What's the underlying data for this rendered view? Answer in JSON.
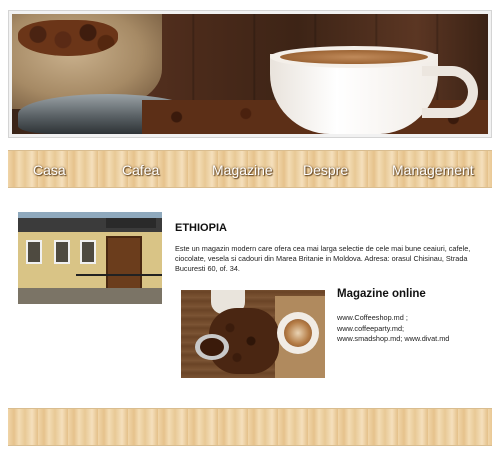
{
  "nav": {
    "items": [
      {
        "label": "Casa"
      },
      {
        "label": "Cafea"
      },
      {
        "label": "Magazine"
      },
      {
        "label": "Despre"
      },
      {
        "label": "Management"
      }
    ]
  },
  "store": {
    "title": "ETHIOPIA",
    "description": "Este un magazin modern care ofera cea mai larga selectie de cele mai bune ceaiuri, cafele, ciocolate, vesela si cadouri din Marea Britanie in Moldova. Adresa: orasul Chisinau, Strada Bucuresti 60, of. 34."
  },
  "online": {
    "title": "Magazine online",
    "links_line1": "www.Coffeeshop.md ;",
    "links_line2": "www.coffeeparty.md;",
    "links_line3": "www.smadshop.md;  www.divat.md"
  },
  "colors": {
    "wood_light": "#f0d5a8",
    "wood_dark": "#e4c089",
    "nav_text": "#ffffff"
  }
}
